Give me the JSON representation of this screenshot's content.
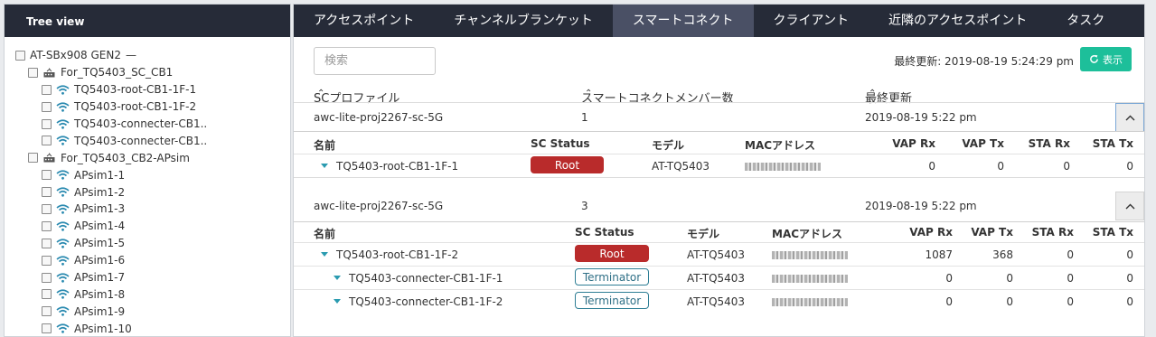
{
  "tree": {
    "title": "Tree view",
    "root": "AT-SBx908 GEN2",
    "root_suffix": "—",
    "group1": "For_TQ5403_SC_CB1",
    "group1_items": [
      "TQ5403-root-CB1-1F-1",
      "TQ5403-root-CB1-1F-2",
      "TQ5403-connecter-CB1..",
      "TQ5403-connecter-CB1.."
    ],
    "group2": "For_TQ5403_CB2-APsim",
    "group2_items": [
      "APsim1-1",
      "APsim1-2",
      "APsim1-3",
      "APsim1-4",
      "APsim1-5",
      "APsim1-6",
      "APsim1-7",
      "APsim1-8",
      "APsim1-9",
      "APsim1-10"
    ]
  },
  "tabs": [
    "アクセスポイント",
    "チャンネルブランケット",
    "スマートコネクト",
    "クライアント",
    "近隣のアクセスポイント",
    "タスク"
  ],
  "active_tab": "スマートコネクト",
  "toolbar": {
    "search_placeholder": "検索",
    "last_update": "最終更新: 2019-08-19 5:24:29 pm",
    "show_label": "表示"
  },
  "sc_columns": {
    "profile": "SCプロファイル",
    "members": "スマートコネクトメンバー数",
    "last_update": "最終更新",
    "sort_icon": "⌃"
  },
  "groups": [
    {
      "profile": "awc-lite-proj2267-sc-5G",
      "members": "1",
      "last_update": "2019-08-19 5:22 pm",
      "columns": [
        "名前",
        "SC Status",
        "モデル",
        "MACアドレス",
        "VAP Rx",
        "VAP Tx",
        "STA Rx",
        "STA Tx"
      ],
      "rows": [
        {
          "name": "TQ5403-root-CB1-1F-1",
          "status": "Root",
          "model": "AT-TQ5403",
          "vap_rx": "0",
          "vap_tx": "0",
          "sta_rx": "0",
          "sta_tx": "0"
        }
      ]
    },
    {
      "profile": "awc-lite-proj2267-sc-5G",
      "members": "3",
      "last_update": "2019-08-19 5:22 pm",
      "columns": [
        "名前",
        "SC Status",
        "モデル",
        "MACアドレス",
        "VAP Rx",
        "VAP Tx",
        "STA Rx",
        "STA Tx"
      ],
      "rows": [
        {
          "name": "TQ5403-root-CB1-1F-2",
          "status": "Root",
          "model": "AT-TQ5403",
          "vap_rx": "1087",
          "vap_tx": "368",
          "sta_rx": "0",
          "sta_tx": "0"
        },
        {
          "name": "TQ5403-connecter-CB1-1F-1",
          "status": "Terminator",
          "model": "AT-TQ5403",
          "vap_rx": "0",
          "vap_tx": "0",
          "sta_rx": "0",
          "sta_tx": "0"
        },
        {
          "name": "TQ5403-connecter-CB1-1F-2",
          "status": "Terminator",
          "model": "AT-TQ5403",
          "vap_rx": "0",
          "vap_tx": "0",
          "sta_rx": "0",
          "sta_tx": "0"
        }
      ]
    }
  ],
  "colors": {
    "header_bg": "#262b38",
    "active_tab": "#4a5065",
    "show_button": "#1dbf9a",
    "root_badge": "#b92b2b",
    "terminator_border": "#2e7e95",
    "caret": "#2a9bb0"
  },
  "icons": {
    "switch": "switch-icon",
    "wifi": "wifi-icon",
    "refresh": "refresh-icon",
    "collapse": "chevron-up-icon",
    "sort": "sort-up-icon",
    "expand": "caret-down-icon"
  }
}
